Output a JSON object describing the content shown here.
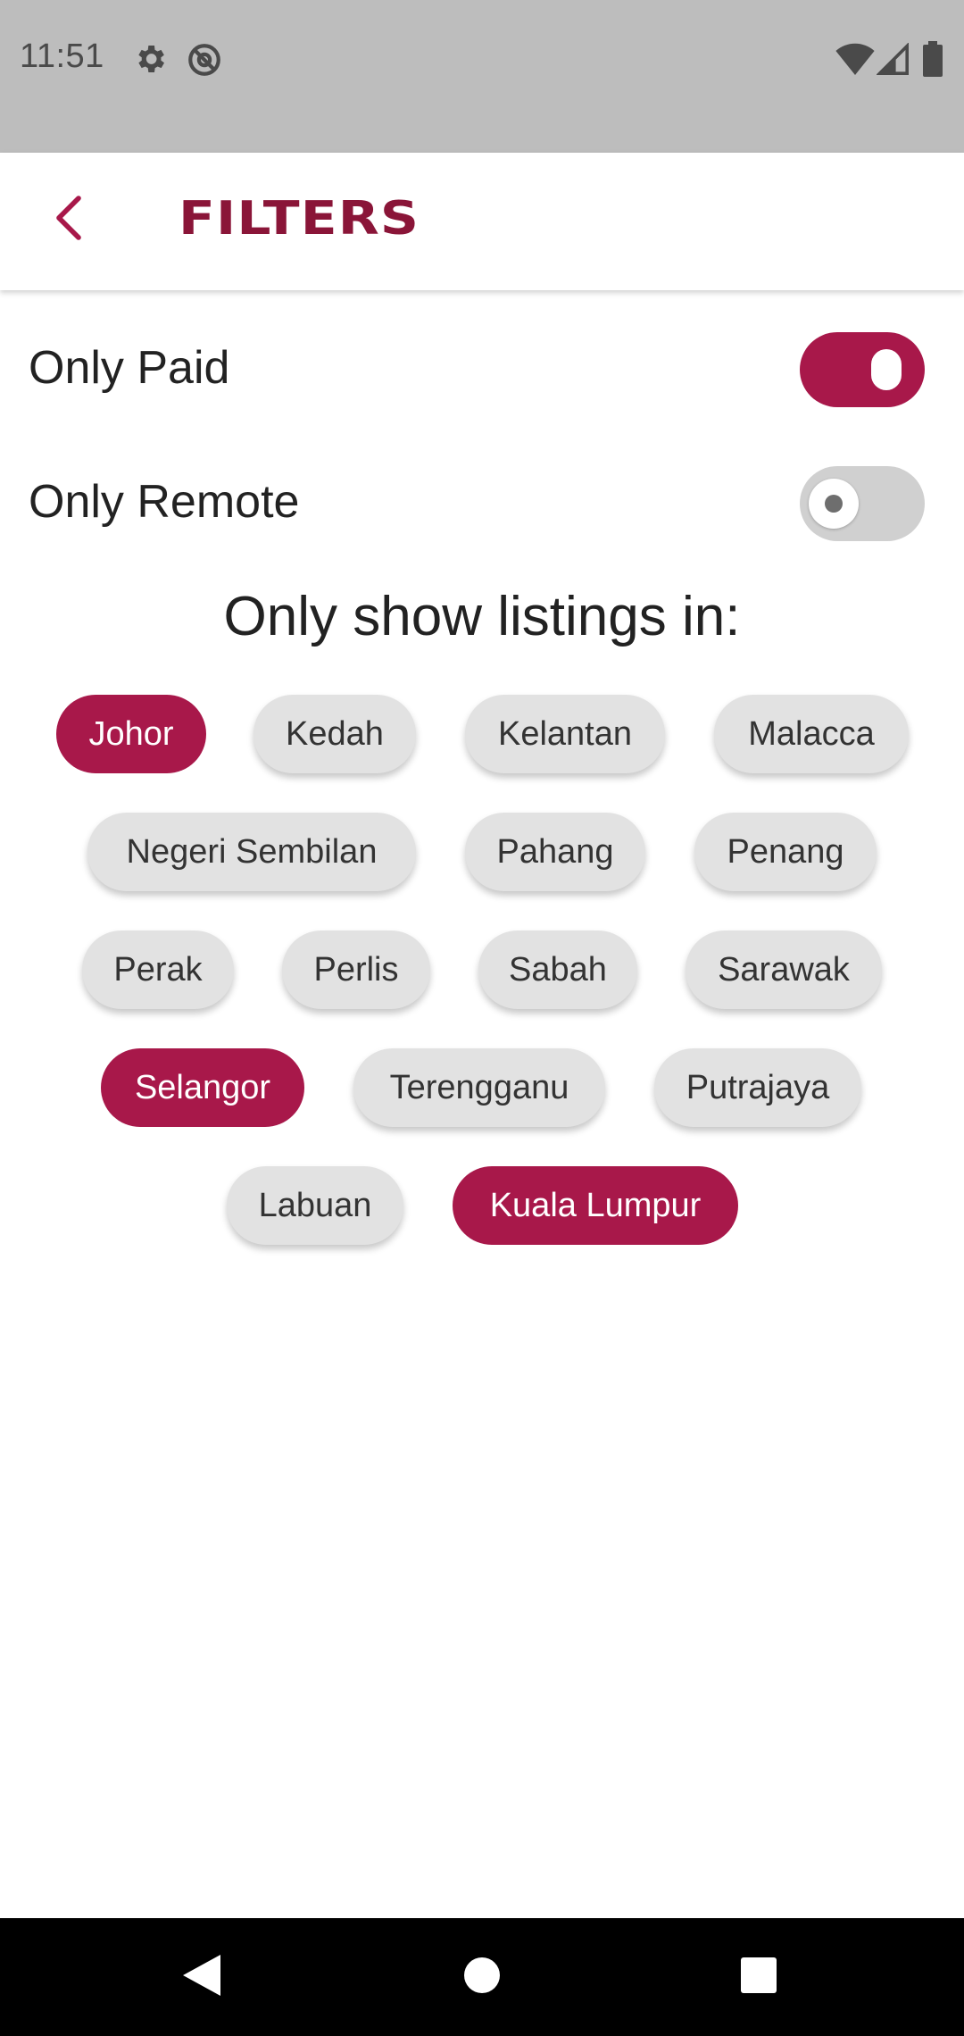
{
  "status_bar": {
    "time": "11:51",
    "icons": [
      "gear-icon",
      "at-sign-icon",
      "wifi-icon",
      "signal-icon",
      "battery-icon"
    ]
  },
  "app_bar": {
    "title": "FILTERS",
    "back_icon": "chevron-left-icon"
  },
  "toggles": [
    {
      "label": "Only Paid",
      "checked": true
    },
    {
      "label": "Only Remote",
      "checked": false
    }
  ],
  "section_title": "Only show listings in:",
  "chips": [
    {
      "label": "Johor",
      "selected": true
    },
    {
      "label": "Kedah",
      "selected": false
    },
    {
      "label": "Kelantan",
      "selected": false
    },
    {
      "label": "Malacca",
      "selected": false
    },
    {
      "label": "Negeri Sembilan",
      "selected": false
    },
    {
      "label": "Pahang",
      "selected": false
    },
    {
      "label": "Penang",
      "selected": false
    },
    {
      "label": "Perak",
      "selected": false
    },
    {
      "label": "Perlis",
      "selected": false
    },
    {
      "label": "Sabah",
      "selected": false
    },
    {
      "label": "Sarawak",
      "selected": false
    },
    {
      "label": "Selangor",
      "selected": true
    },
    {
      "label": "Terengganu",
      "selected": false
    },
    {
      "label": "Putrajaya",
      "selected": false
    },
    {
      "label": "Labuan",
      "selected": false
    },
    {
      "label": "Kuala Lumpur",
      "selected": true
    }
  ],
  "nav_bar": {
    "icons": [
      "nav-back-icon",
      "nav-home-icon",
      "nav-recents-icon"
    ]
  },
  "colors": {
    "accent": "#a8184a",
    "title": "#8a1538",
    "chip_unselected": "#e2e2e2",
    "status_bar": "#bdbdbd"
  }
}
